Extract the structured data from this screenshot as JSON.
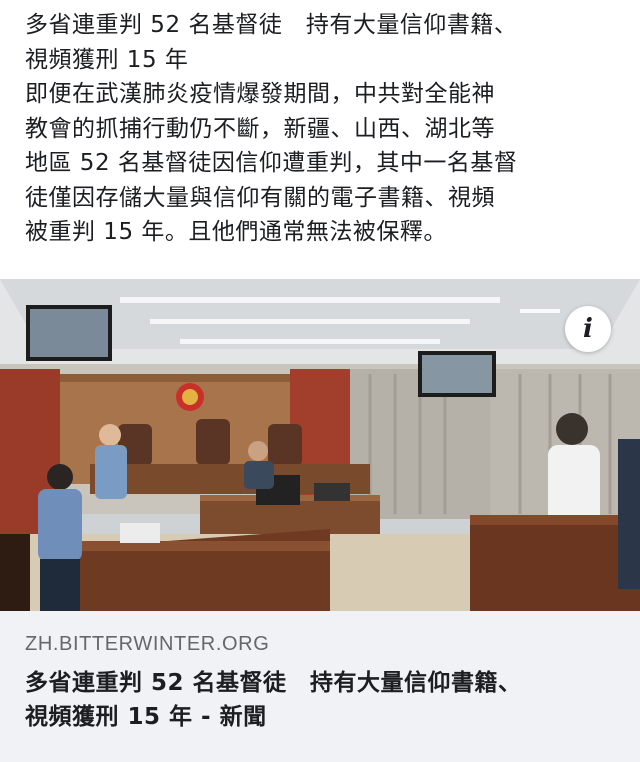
{
  "post": {
    "lines": [
      "多省連重判 52 名基督徒　持有大量信仰書籍、",
      "視頻獲刑 15 年",
      "即便在武漢肺炎疫情爆發期間，中共對全能神",
      "教會的抓捕行動仍不斷，新疆、山西、湖北等",
      "地區 52 名基督徒因信仰遭重判，其中一名基督",
      "徒僅因存儲大量與信仰有關的電子書籍、視頻",
      "被重判 15 年。且他們通常無法被保釋。"
    ]
  },
  "link_preview": {
    "image_icon": "courtroom-photo",
    "info_icon_label": "i",
    "domain": "ZH.BITTERWINTER.ORG",
    "title_lines": [
      "多省連重判 52 名基督徒　持有大量信仰書籍、",
      "視頻獲刑 15 年 - 新聞"
    ]
  },
  "colors": {
    "text": "#1c1e21",
    "muted": "#65676b",
    "card_background": "#f0f2f5"
  }
}
